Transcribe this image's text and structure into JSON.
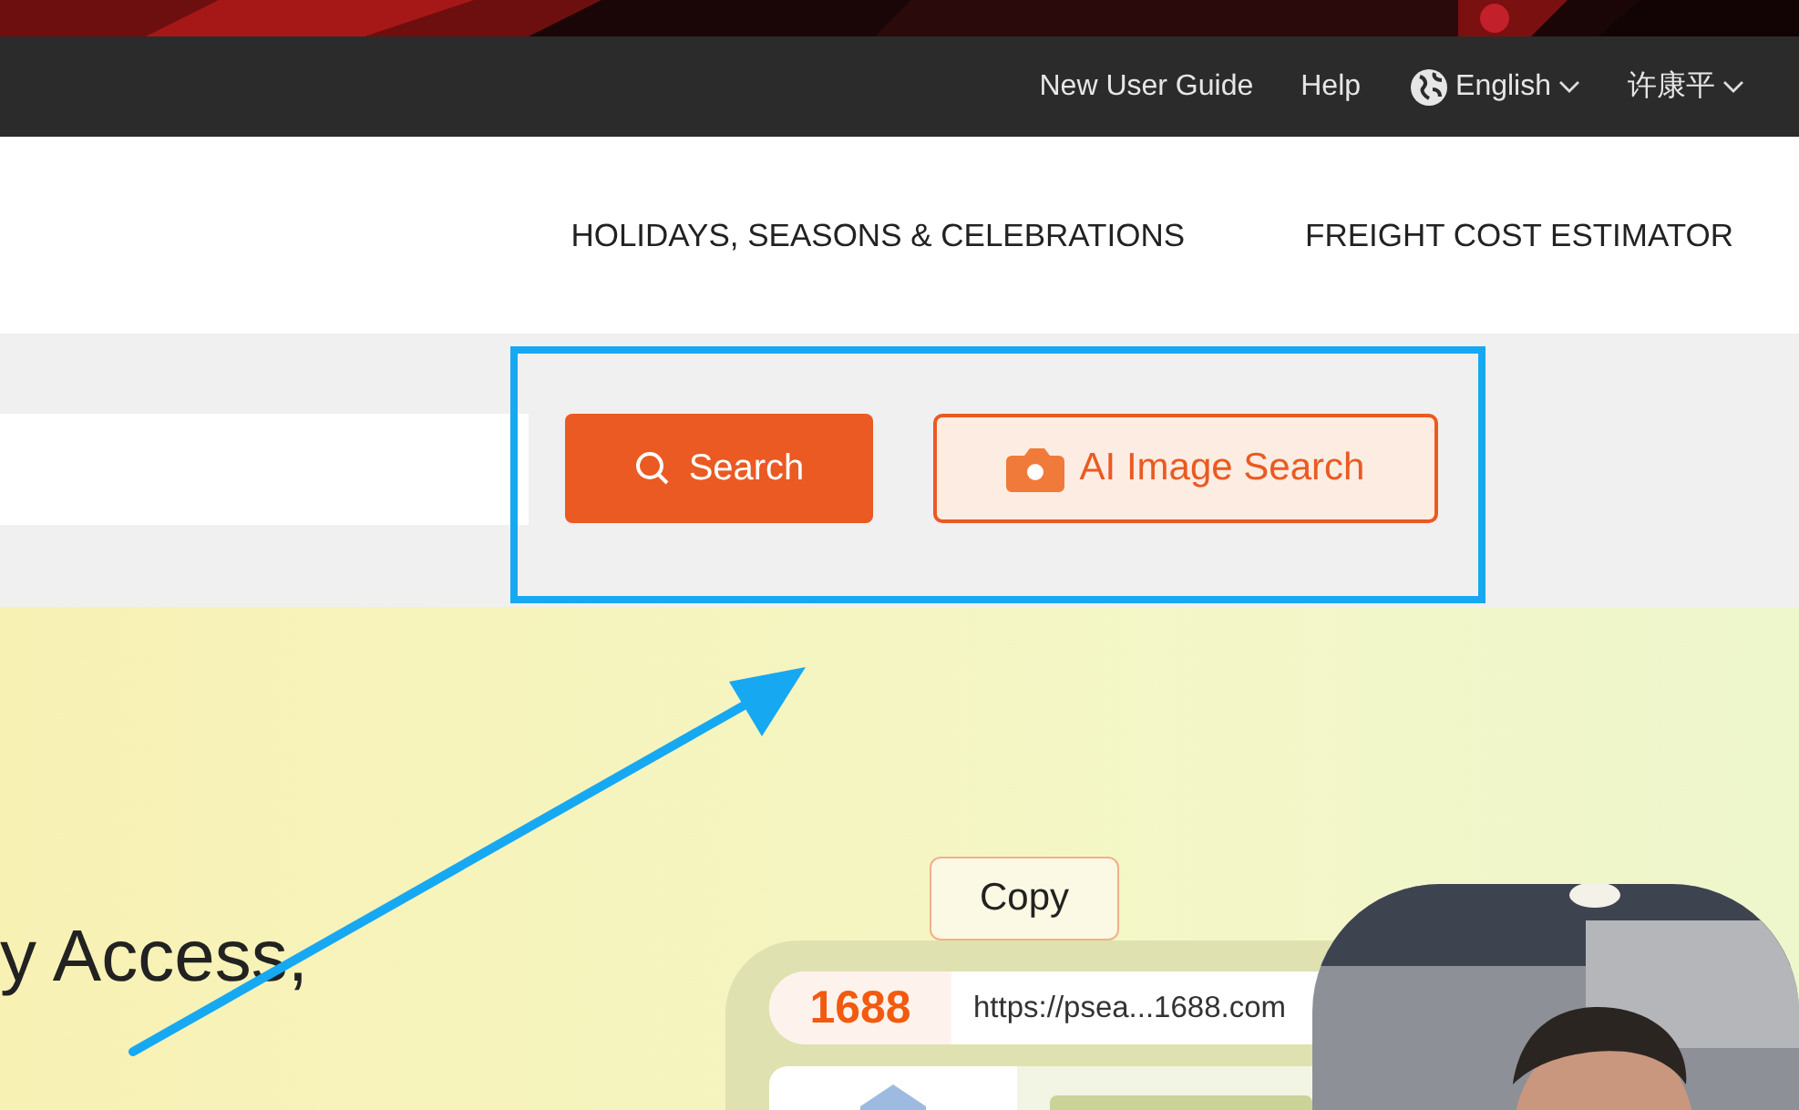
{
  "top_bar": {
    "links": [
      {
        "label": "New User Guide",
        "kind": "link"
      },
      {
        "label": "Help",
        "kind": "link"
      },
      {
        "label": "English",
        "kind": "language"
      },
      {
        "label": "许康平",
        "kind": "account"
      }
    ]
  },
  "nav": {
    "items": [
      "HOLIDAYS, SEASONS & CELEBRATIONS",
      "FREIGHT COST ESTIMATOR"
    ]
  },
  "search": {
    "search_button": "Search",
    "image_search_button": "AI Image Search"
  },
  "annotation": {
    "highlight": true,
    "arrow": true
  },
  "hero": {
    "heading": "y Access,",
    "tooltip": "Copy",
    "url_bar": {
      "logo": "1688",
      "url": "https://psea...1688.com"
    }
  }
}
